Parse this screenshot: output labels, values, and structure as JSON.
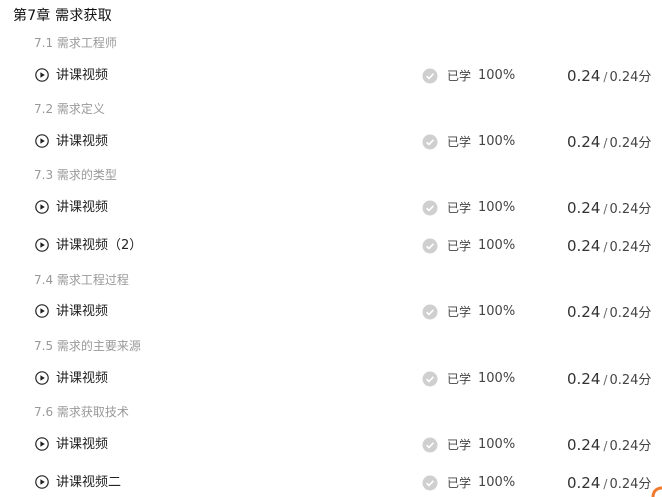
{
  "chapter": {
    "title": "第7章 需求获取"
  },
  "sections": [
    {
      "title": "7.1 需求工程师",
      "items": [
        {
          "label": "讲课视频",
          "status": "已学",
          "progress": "100%",
          "score": "0.24",
          "total": "0.24分"
        }
      ]
    },
    {
      "title": "7.2 需求定义",
      "items": [
        {
          "label": "讲课视频",
          "status": "已学",
          "progress": "100%",
          "score": "0.24",
          "total": "0.24分"
        }
      ]
    },
    {
      "title": "7.3 需求的类型",
      "items": [
        {
          "label": "讲课视频",
          "status": "已学",
          "progress": "100%",
          "score": "0.24",
          "total": "0.24分"
        },
        {
          "label": "讲课视频（2）",
          "status": "已学",
          "progress": "100%",
          "score": "0.24",
          "total": "0.24分"
        }
      ]
    },
    {
      "title": "7.4 需求工程过程",
      "items": [
        {
          "label": "讲课视频",
          "status": "已学",
          "progress": "100%",
          "score": "0.24",
          "total": "0.24分"
        }
      ]
    },
    {
      "title": "7.5 需求的主要来源",
      "items": [
        {
          "label": "讲课视频",
          "status": "已学",
          "progress": "100%",
          "score": "0.24",
          "total": "0.24分"
        }
      ]
    },
    {
      "title": "7.6 需求获取技术",
      "items": [
        {
          "label": "讲课视频",
          "status": "已学",
          "progress": "100%",
          "score": "0.24",
          "total": "0.24分"
        },
        {
          "label": "讲课视频二",
          "status": "已学",
          "progress": "100%",
          "score": "0.24",
          "total": "0.24分"
        }
      ]
    }
  ],
  "icons": {
    "play": "play-circle-icon",
    "check": "check-circle-icon",
    "corner": "corner-badge-icon"
  },
  "colors": {
    "check": "#cfcfcf",
    "corner": "#f07a2f",
    "section": "#999999"
  }
}
